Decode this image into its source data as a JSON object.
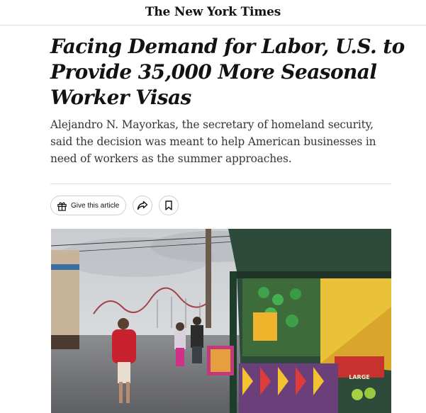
{
  "masthead": {
    "logo_text": "The New York Times"
  },
  "article": {
    "headline": "Facing Demand for Labor, U.S. to Provide 35,000 More Seasonal Worker Visas",
    "summary": "Alejandro N. Mayorkas, the secretary of homeland security, said the decision was meant to help American businesses in need of workers as the summer approaches."
  },
  "tools": {
    "gift_label": "Give this article",
    "gift_icon": "gift-icon",
    "share_icon": "share-arrow-icon",
    "save_icon": "bookmark-icon"
  },
  "photo": {
    "sign_text": "LARGE"
  }
}
